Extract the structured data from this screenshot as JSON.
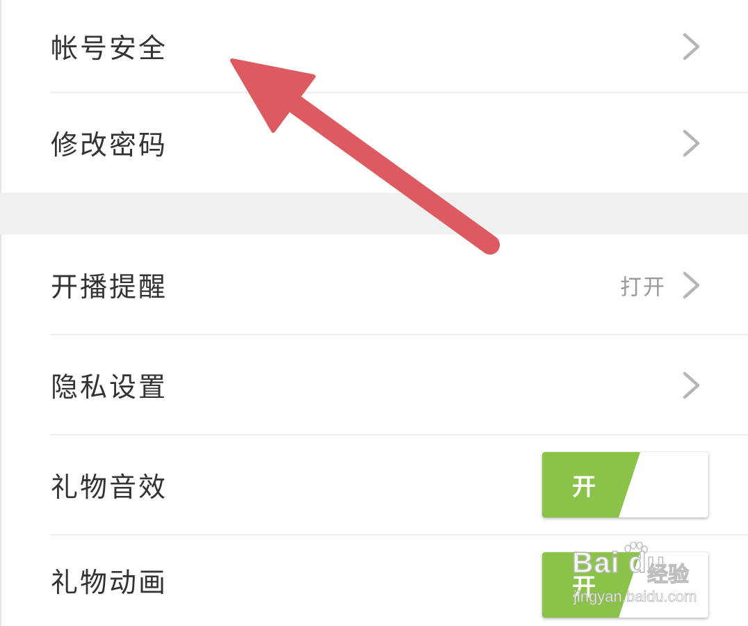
{
  "settings": {
    "rows": [
      {
        "label": "帐号安全"
      },
      {
        "label": "修改密码"
      },
      {
        "label": "开播提醒",
        "value": "打开"
      },
      {
        "label": "隐私设置"
      },
      {
        "label": "礼物音效",
        "toggle": "开"
      },
      {
        "label": "礼物动画",
        "toggle": "开"
      }
    ]
  },
  "watermark": {
    "brand": "Bai du",
    "cn": "经验",
    "url": "jingyan.baidu.com"
  },
  "colors": {
    "toggle_on": "#8bc34a",
    "annotation_arrow": "#dc5a60",
    "section_gap": "#f0f0f0"
  },
  "icons": {
    "row_chevron": "chevron-right-icon",
    "annotation": "red-arrow-annotation"
  }
}
